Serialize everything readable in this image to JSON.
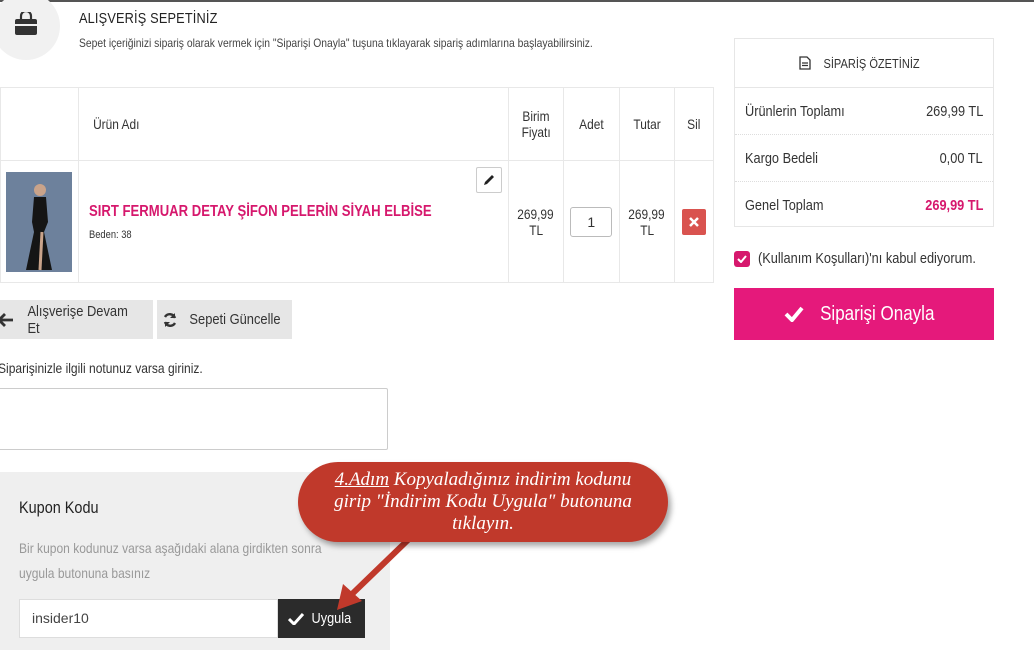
{
  "header": {
    "title": "ALIŞVERİŞ SEPETİNİZ",
    "subtitle": "Sepet içeriğinizi sipariş olarak vermek için \"Siparişi Onayla\" tuşuna tıklayarak sipariş adımlarına başlayabilirsiniz.",
    "icon": "shopping-bag-icon"
  },
  "cart": {
    "columns": {
      "name": "Ürün Adı",
      "unit_price_line1": "Birim",
      "unit_price_line2": "Fiyatı",
      "qty": "Adet",
      "total": "Tutar",
      "delete": "Sil"
    },
    "items": [
      {
        "name": "SIRT FERMUAR DETAY ŞİFON PELERİN SİYAH ELBİSE",
        "size": "Beden: 38",
        "unit_price_value": "269,99",
        "unit_price_currency": "TL",
        "qty": "1",
        "total_value": "269,99",
        "total_currency": "TL"
      }
    ]
  },
  "actions": {
    "continue_label": "Alışverişe Devam Et",
    "update_label": "Sepeti Güncelle"
  },
  "note": {
    "label": "Siparişinizle ilgili notunuz varsa giriniz.",
    "value": ""
  },
  "coupon": {
    "title": "Kupon Kodu",
    "description": "Bir kupon kodunuz varsa aşağıdaki alana girdikten sonra uygula butonuna basınız",
    "value": "insider10",
    "button_label": "Uygula"
  },
  "summary": {
    "title": "SİPARİŞ ÖZETİNİZ",
    "rows": [
      {
        "label": "Ürünlerin Toplamı",
        "value": "269,99 TL"
      },
      {
        "label": "Kargo Bedeli",
        "value": "0,00 TL"
      },
      {
        "label": "Genel Toplam",
        "value": "269,99 TL"
      }
    ]
  },
  "terms": {
    "label": "(Kullanım Koşulları)'nı kabul ediyorum.",
    "checked": true
  },
  "confirm_label": "Siparişi Onayla",
  "annotation": {
    "step": "4.Adım",
    "text": " Kopyaladığınız indirim kodunu girip \"İndirim Kodu Uygula\" butonuna tıklayın."
  },
  "colors": {
    "brand_pink": "#e5197b",
    "delete_red": "#d9534f",
    "callout_red": "#c0392b"
  }
}
